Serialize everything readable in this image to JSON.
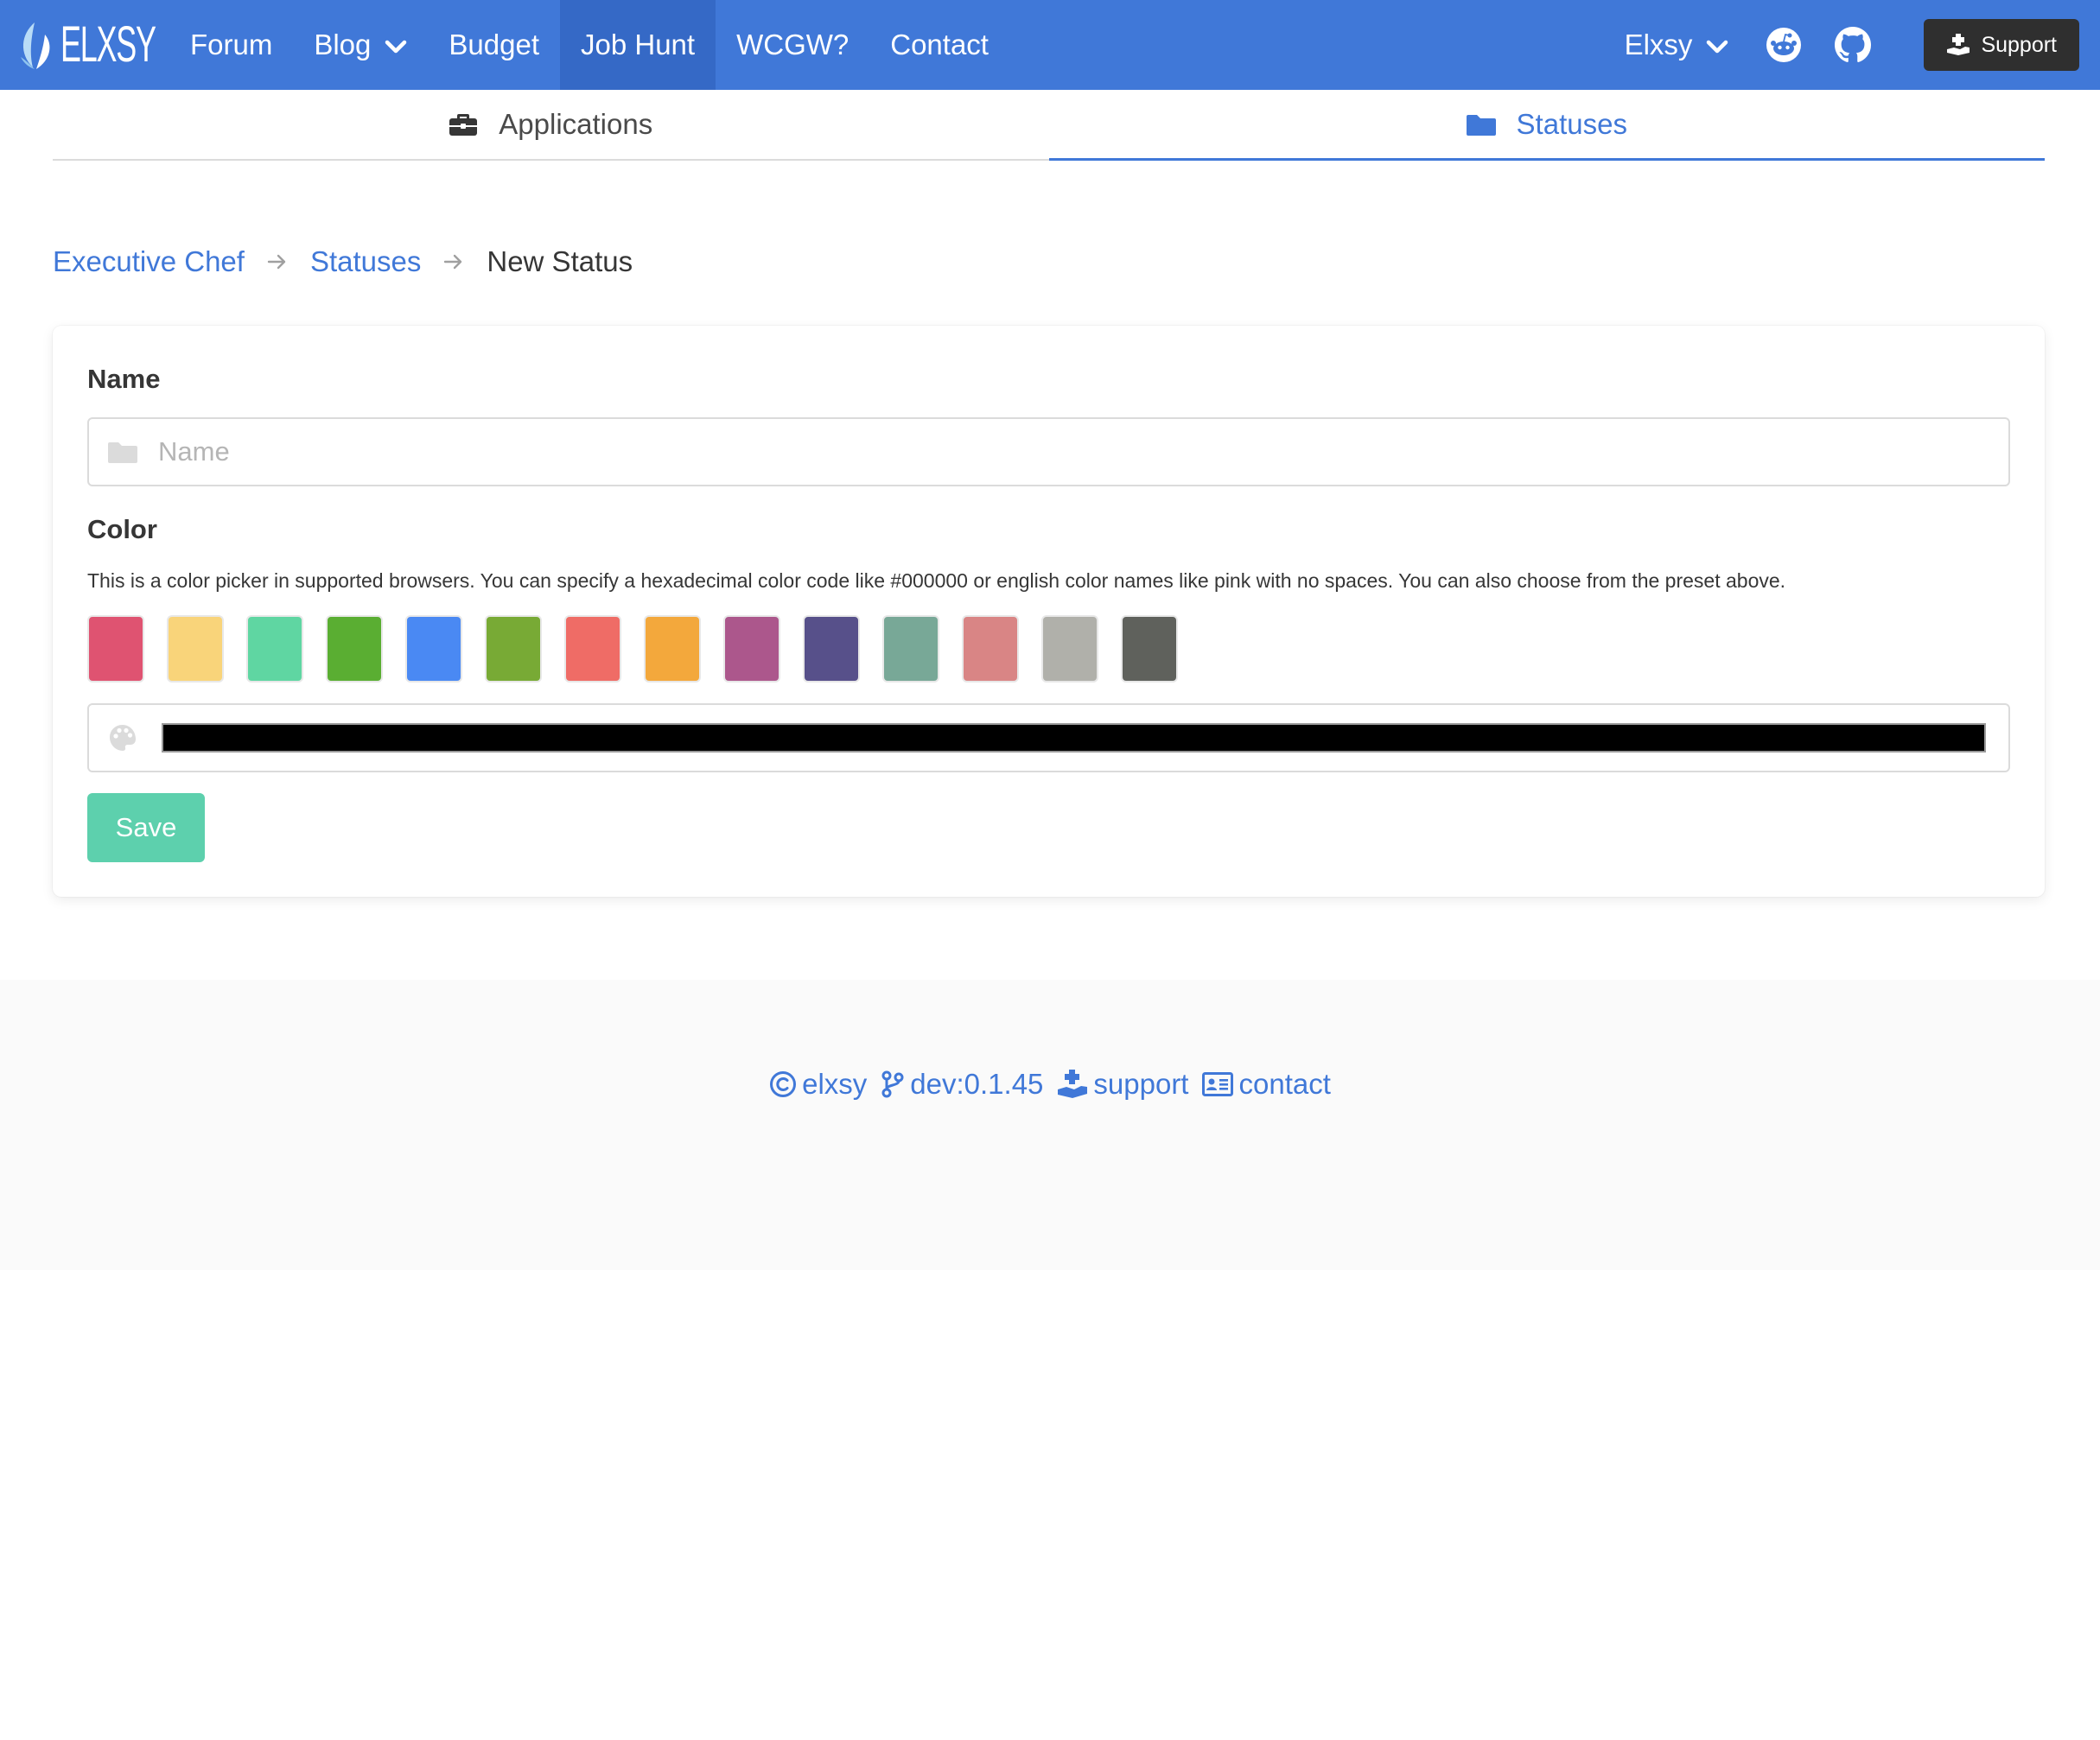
{
  "nav": {
    "brand": "ELXSY",
    "items": [
      {
        "label": "Forum"
      },
      {
        "label": "Blog"
      },
      {
        "label": "Budget"
      },
      {
        "label": "Job Hunt"
      },
      {
        "label": "WCGW?"
      },
      {
        "label": "Contact"
      }
    ],
    "active_item": "Job Hunt",
    "user_label": "Elxsy",
    "support_label": "Support"
  },
  "tabs": {
    "applications": "Applications",
    "statuses": "Statuses",
    "active": "Statuses"
  },
  "breadcrumb": {
    "items": [
      "Executive Chef",
      "Statuses"
    ],
    "current": "New Status"
  },
  "form": {
    "name_label": "Name",
    "name_placeholder": "Name",
    "name_value": "",
    "color_label": "Color",
    "color_help": "This is a color picker in supported browsers. You can specify a hexadecimal color code like #000000 or english color names like pink with no spaces. You can also choose from the preset above.",
    "color_value": "#000000",
    "swatches": [
      "#df5371",
      "#f9d47a",
      "#5fd6a2",
      "#5aae32",
      "#4a89f3",
      "#78aa35",
      "#ef6c66",
      "#f3a83c",
      "#ac578c",
      "#57508a",
      "#78a897",
      "#d98585",
      "#b0b0aa",
      "#5f615c"
    ],
    "save_label": "Save"
  },
  "footer": {
    "copyright": "elxsy",
    "version": "dev:0.1.45",
    "support": "support",
    "contact": "contact"
  },
  "colors": {
    "primary": "#4078d8",
    "primary_dark": "#3569c6",
    "success": "#5dd0ad",
    "dark_button": "#2f2f2f"
  }
}
